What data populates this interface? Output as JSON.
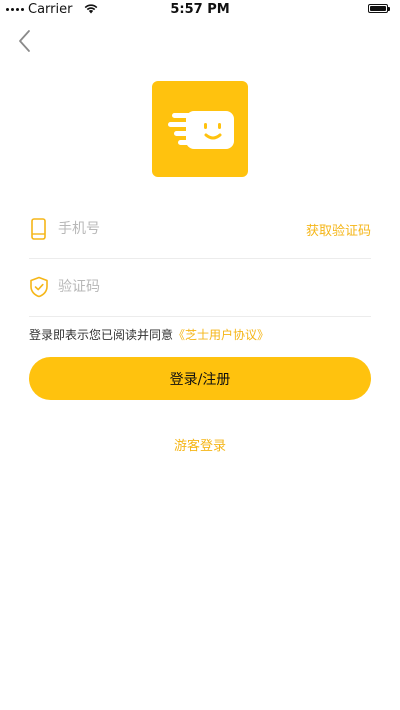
{
  "status_bar": {
    "carrier": "Carrier",
    "time": "5:57 PM"
  },
  "login": {
    "phone_placeholder": "手机号",
    "get_code_label": "获取验证码",
    "code_placeholder": "验证码",
    "agreement_text": "登录即表示您已阅读并同意",
    "agreement_link": "《芝士用户协议》",
    "submit_label": "登录/注册",
    "guest_label": "游客登录"
  },
  "icons": {
    "back": "chevron-left-icon",
    "logo": "smiling-card-logo",
    "phone": "phone-icon",
    "code": "shield-check-icon"
  },
  "colors": {
    "accent": "#FFC20E",
    "link": "#F5B618",
    "placeholder": "#B8B8B8",
    "divider": "#ECECEC"
  }
}
